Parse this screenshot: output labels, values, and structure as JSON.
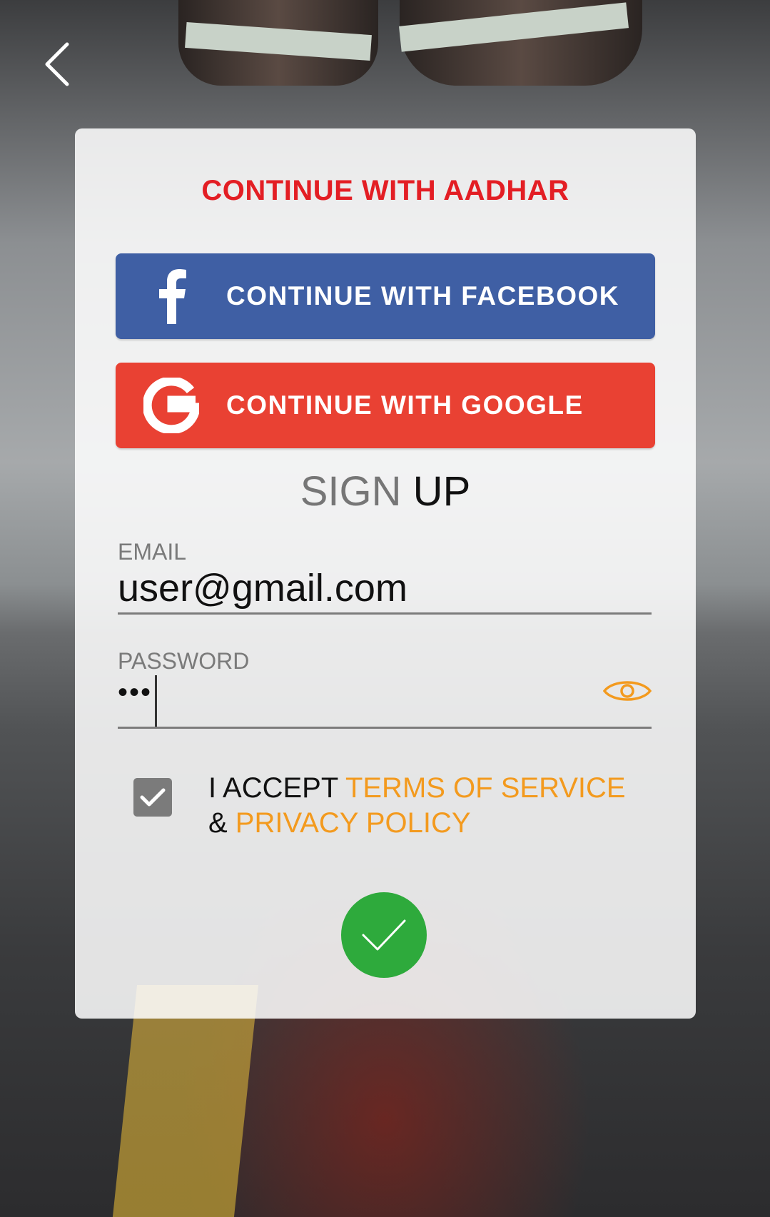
{
  "header": {
    "back_icon": "chevron-left-icon"
  },
  "card": {
    "aadhar_label": "CONTINUE WITH AADHAR",
    "facebook": {
      "icon": "facebook-icon",
      "label": "CONTINUE WITH FACEBOOK",
      "color": "#3f5fa4"
    },
    "google": {
      "icon": "google-icon",
      "label": "CONTINUE WITH GOOGLE",
      "color": "#e94133"
    },
    "title_part1": "SIGN",
    "title_part2": " UP",
    "email": {
      "label": "EMAIL",
      "value": "user@gmail.com"
    },
    "password": {
      "label": "PASSWORD",
      "masked_value": "•••",
      "toggle_icon": "eye-icon"
    },
    "terms": {
      "checked": true,
      "prefix": "I ACCEPT ",
      "terms_link": "TERMS OF SERVICE",
      "joiner": " & ",
      "privacy_link": "PRIVACY POLICY"
    },
    "submit_icon": "checkmark-icon"
  },
  "colors": {
    "aadhar_red": "#e31e24",
    "link_orange": "#f39a1e",
    "submit_green": "#2eaa3c"
  }
}
